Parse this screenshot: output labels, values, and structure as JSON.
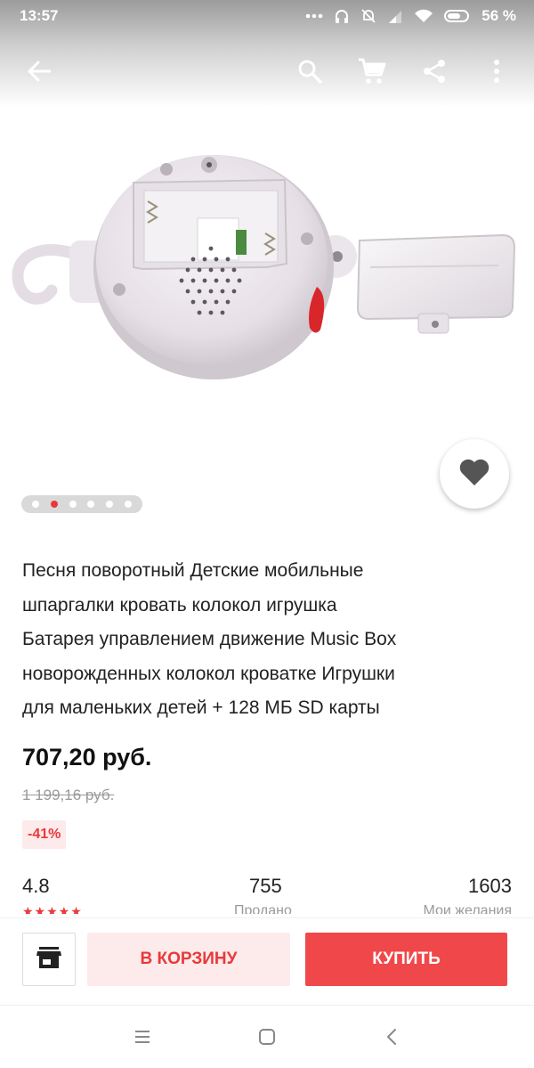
{
  "status_bar": {
    "time": "13:57",
    "battery": "56 %",
    "icons": [
      "dots-icon",
      "headphones-icon",
      "mute-icon",
      "signal-icon",
      "wifi-icon",
      "battery-icon"
    ]
  },
  "toolbar": {
    "icons": [
      "back-arrow-icon",
      "search-icon",
      "cart-icon",
      "share-icon",
      "more-icon"
    ]
  },
  "gallery": {
    "image_count": 6,
    "active_index": 1,
    "favorite_icon": "heart-icon"
  },
  "product": {
    "title_lines": [
      "Песня поворотный Детские мобильные",
      "шпаргалки кровать колокол игрушка",
      "Батарея управлением движение Music Box",
      "новорожденных колокол кроватке Игрушки",
      "для маленьких детей + 128 МБ SD карты"
    ],
    "price": "707,20 руб.",
    "old_price": "1 199,16 руб.",
    "discount": "-41%"
  },
  "stats": {
    "rating": "4.8",
    "stars": "★★★★★",
    "sold_value": "755",
    "sold_label": "Продано",
    "wishlist_value": "1603",
    "wishlist_label": "Мои желания"
  },
  "actions": {
    "store_icon": "store-icon",
    "cart_label": "В КОРЗИНУ",
    "buy_label": "КУПИТЬ"
  },
  "nav_bar": {
    "icons": [
      "menu-icon",
      "home-icon",
      "back-icon"
    ]
  },
  "colors": {
    "accent": "#e8393b",
    "buy_button": "#f0484a",
    "discount_bg": "#fdeaea"
  }
}
